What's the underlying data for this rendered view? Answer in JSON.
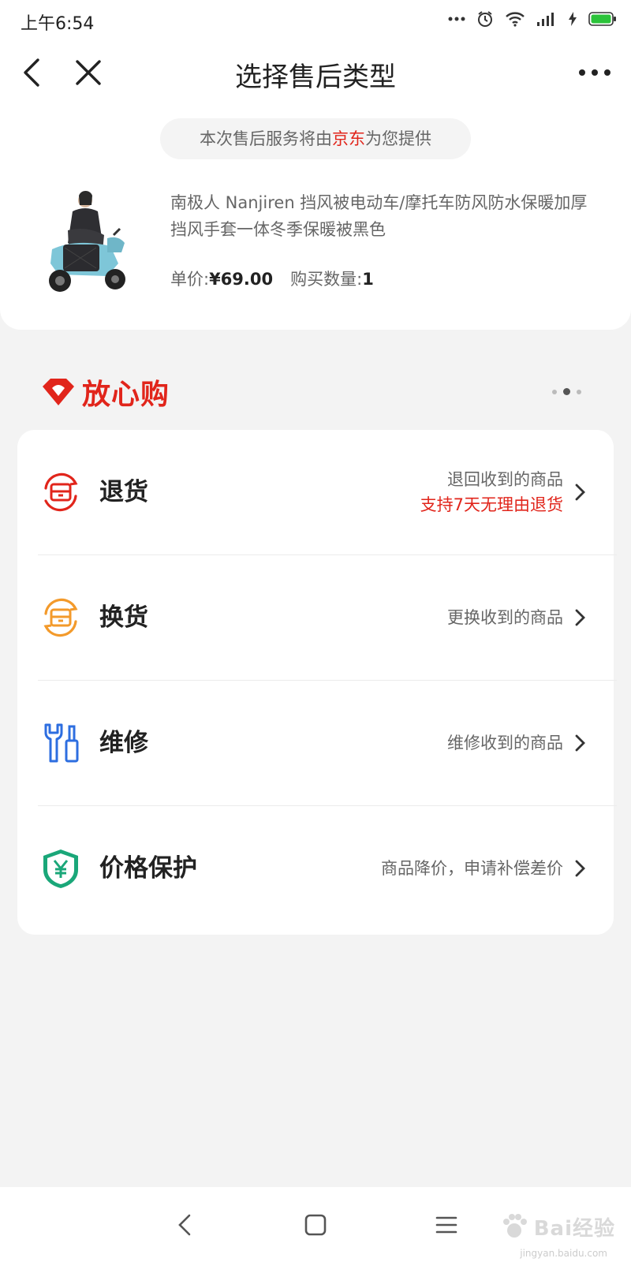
{
  "status_bar": {
    "time": "上午6:54",
    "icons": [
      "more-dots-icon",
      "alarm-icon",
      "wifi-icon",
      "signal-icon",
      "charging-icon",
      "battery-icon"
    ]
  },
  "nav": {
    "title": "选择售后类型",
    "back_icon": "back-chevron-icon",
    "close_icon": "close-icon",
    "more_icon": "more-horizontal-icon"
  },
  "notice": {
    "prefix": "本次售后服务将由",
    "brand": "京东",
    "suffix": "为您提供"
  },
  "product": {
    "title": "南极人 Nanjiren 挡风被电动车/摩托车防风防水保暖加厚挡风手套一体冬季保暖被黑色",
    "price_label": "单价:",
    "price": "¥69.00",
    "qty_label": "购买数量:",
    "qty": "1"
  },
  "assurance": {
    "logo_text": "放心购"
  },
  "services": [
    {
      "title": "退货",
      "desc": "退回收到的商品",
      "highlight": "支持7天无理由退货",
      "icon": "return-box-icon",
      "color": "#e1251b"
    },
    {
      "title": "换货",
      "desc": "更换收到的商品",
      "highlight": "",
      "icon": "exchange-box-icon",
      "color": "#f39a2b"
    },
    {
      "title": "维修",
      "desc": "维修收到的商品",
      "highlight": "",
      "icon": "repair-tools-icon",
      "color": "#2d6ee0"
    },
    {
      "title": "价格保护",
      "desc": "商品降价，申请补偿差价",
      "highlight": "",
      "icon": "price-shield-icon",
      "color": "#1aa779"
    }
  ],
  "system_nav": {
    "back_icon": "system-back-icon",
    "home_icon": "system-home-icon",
    "menu_icon": "system-menu-icon"
  },
  "watermark": {
    "text": "Bai经验",
    "sub": "jingyan.baidu.com"
  }
}
